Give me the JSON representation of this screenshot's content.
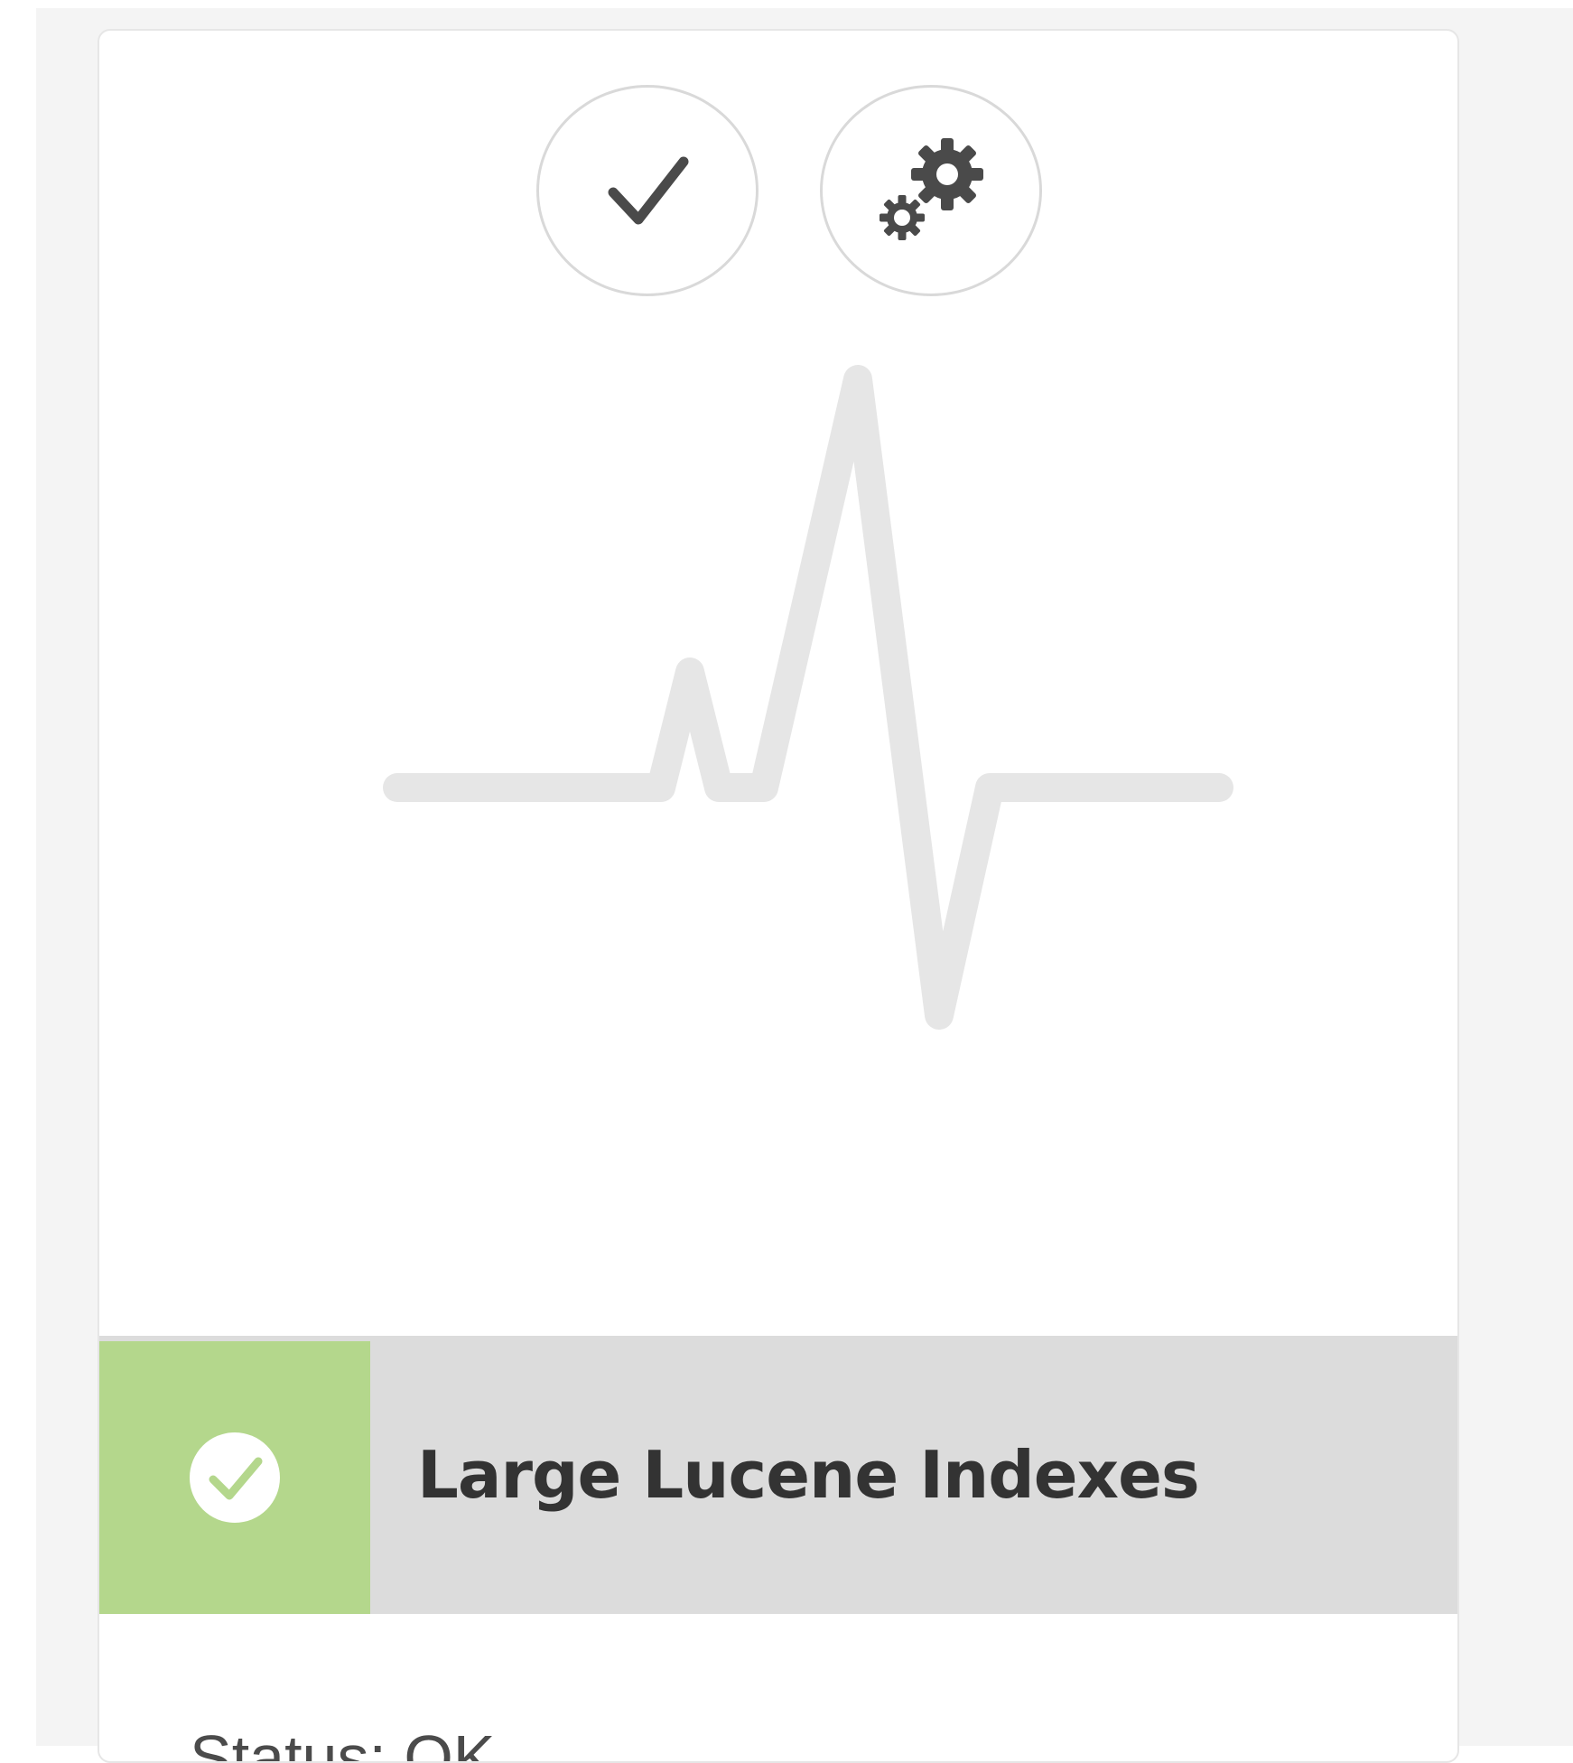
{
  "card": {
    "title": "Large Lucene Indexes",
    "status_text": "Status: OK",
    "status_color": "#b4d78c"
  },
  "actions": [
    {
      "icon": "checkmark-icon"
    },
    {
      "icon": "gears-icon"
    }
  ],
  "illustration": {
    "icon": "heartbeat-pulse-icon"
  }
}
